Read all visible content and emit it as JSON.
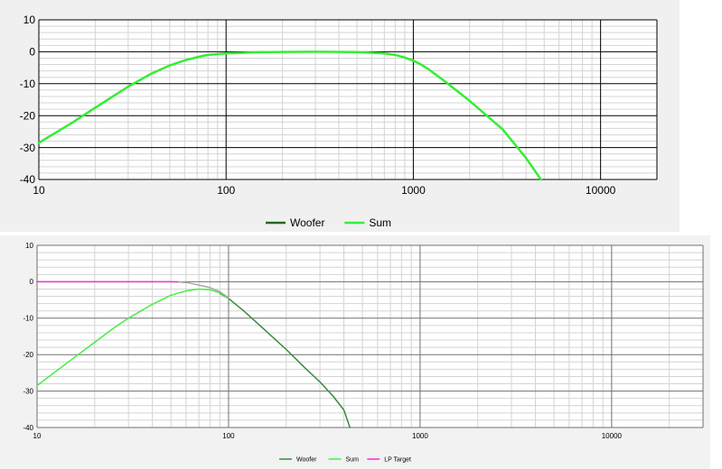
{
  "chart_data": [
    {
      "type": "line",
      "x_scale": "log",
      "xlim": [
        10,
        20000
      ],
      "ylim": [
        -40,
        10
      ],
      "x_ticks": [
        10,
        100,
        1000,
        10000
      ],
      "x_tick_labels": [
        "10",
        "100",
        "1000",
        "10000"
      ],
      "y_ticks": [
        10,
        0,
        -10,
        -20,
        -30,
        -40
      ],
      "y_tick_labels": [
        "10",
        "0",
        "-10",
        "-20",
        "-30",
        "-40"
      ],
      "grid": true,
      "legend_placement": "bottom-center",
      "series": [
        {
          "name": "Woofer",
          "color": "#1e6b1e",
          "x": [
            10,
            4800
          ],
          "y": [
            0,
            0
          ],
          "visible_line": false
        },
        {
          "name": "Sum",
          "color": "#33ee33",
          "x": [
            10,
            15,
            20,
            30,
            40,
            50,
            60,
            70,
            80,
            100,
            150,
            200,
            300,
            500,
            700,
            800,
            900,
            1000,
            1100,
            1200,
            1500,
            2000,
            3000,
            4000,
            4800
          ],
          "y": [
            -28.5,
            -22.3,
            -17.5,
            -10.9,
            -6.8,
            -4.3,
            -2.7,
            -1.7,
            -1.0,
            -0.5,
            -0.15,
            -0.05,
            0,
            -0.1,
            -0.5,
            -1.0,
            -1.8,
            -2.8,
            -4.0,
            -5.4,
            -9.6,
            -15.4,
            -24.3,
            -33.3,
            -40
          ]
        }
      ]
    },
    {
      "type": "line",
      "x_scale": "log",
      "xlim": [
        10,
        30000
      ],
      "ylim": [
        -40,
        10
      ],
      "x_ticks": [
        10,
        100,
        1000,
        10000
      ],
      "x_tick_labels": [
        "10",
        "100",
        "1000",
        "10000"
      ],
      "y_ticks": [
        10,
        0,
        -10,
        -20,
        -30,
        -40
      ],
      "y_tick_labels": [
        "10",
        "0",
        "-10",
        "-20",
        "-30",
        "-40"
      ],
      "grid": true,
      "legend_placement": "bottom-center",
      "series": [
        {
          "name": "Woofer",
          "color": "#3a8a3a",
          "x": [
            90,
            100,
            120,
            150,
            200,
            250,
            300,
            350,
            400,
            430
          ],
          "y": [
            -3.2,
            -4.6,
            -8.0,
            -12.6,
            -18.6,
            -23.6,
            -27.5,
            -31.3,
            -35.2,
            -40
          ]
        },
        {
          "name": "Sum",
          "color": "#44ee44",
          "x": [
            10,
            15,
            20,
            25,
            30,
            40,
            50,
            60,
            70,
            80,
            90,
            100
          ],
          "y": [
            -28.5,
            -21.5,
            -16.6,
            -12.8,
            -10.0,
            -6.2,
            -3.7,
            -2.5,
            -2.0,
            -2.2,
            -3.0,
            -4.6
          ]
        },
        {
          "name": "LP Target",
          "color": "#ee33cc",
          "x": [
            10,
            20,
            30,
            40,
            50,
            55
          ],
          "y": [
            0,
            0,
            0,
            0,
            0,
            -0.05
          ]
        },
        {
          "name": "",
          "color": "#a8a8a8",
          "x": [
            55,
            60,
            70,
            80,
            90,
            100
          ],
          "y": [
            -0.05,
            -0.2,
            -0.9,
            -1.6,
            -2.7,
            -4.4
          ]
        }
      ]
    }
  ]
}
